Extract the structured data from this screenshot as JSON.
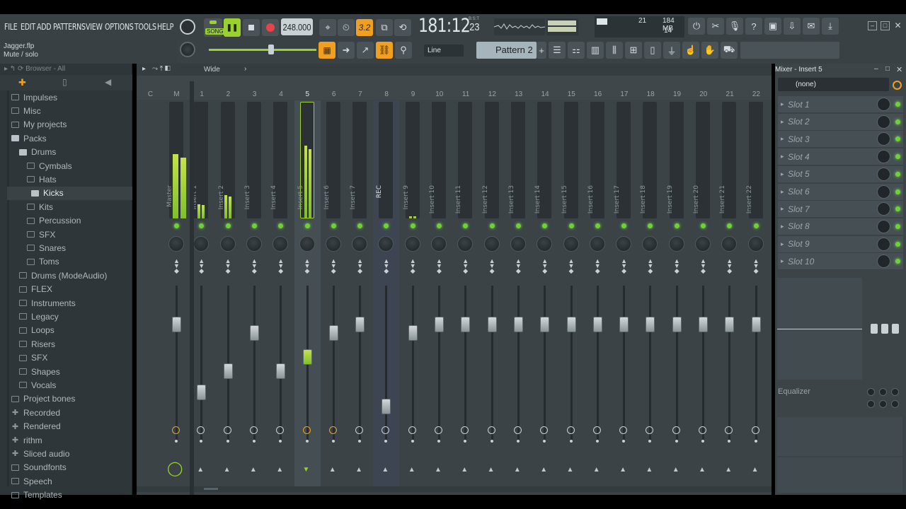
{
  "menu": [
    "FILE",
    "EDIT",
    "ADD",
    "PATTERNS",
    "VIEW",
    "OPTIONS",
    "TOOLS",
    "HELP"
  ],
  "transport": {
    "mode_label": "SONG",
    "tempo": "248.000",
    "time": "181:12",
    "time_ticks": "23",
    "time_unit": "B:S:T",
    "snap_label": "3.2"
  },
  "monitor": {
    "cpu_value": "21",
    "memory": "184 MB",
    "polyphony": "14"
  },
  "hint": {
    "title": "Jagger.flp",
    "message": "Mute / solo"
  },
  "toolbar2": {
    "line_mode": "Line",
    "pattern": "Pattern 2",
    "plus": "+"
  },
  "browser": {
    "header": "Browser - All",
    "items": [
      {
        "label": "Impulses",
        "type": "folder"
      },
      {
        "label": "Misc",
        "type": "folder"
      },
      {
        "label": "My projects",
        "type": "folder"
      },
      {
        "label": "Packs",
        "type": "folder-open"
      },
      {
        "label": "Drums",
        "type": "folder-open",
        "indent": 1
      },
      {
        "label": "Cymbals",
        "type": "folder",
        "indent": 2
      },
      {
        "label": "Hats",
        "type": "folder",
        "indent": 2
      },
      {
        "label": "Kicks",
        "type": "folder",
        "indent": 2,
        "selected": true
      },
      {
        "label": "Kits",
        "type": "folder",
        "indent": 2
      },
      {
        "label": "Percussion",
        "type": "folder",
        "indent": 2
      },
      {
        "label": "SFX",
        "type": "folder",
        "indent": 2
      },
      {
        "label": "Snares",
        "type": "folder",
        "indent": 2
      },
      {
        "label": "Toms",
        "type": "folder",
        "indent": 2
      },
      {
        "label": "Drums (ModeAudio)",
        "type": "folder",
        "indent": 1
      },
      {
        "label": "FLEX",
        "type": "folder",
        "indent": 1
      },
      {
        "label": "Instruments",
        "type": "folder",
        "indent": 1
      },
      {
        "label": "Legacy",
        "type": "folder",
        "indent": 1
      },
      {
        "label": "Loops",
        "type": "folder",
        "indent": 1
      },
      {
        "label": "Risers",
        "type": "folder",
        "indent": 1
      },
      {
        "label": "SFX",
        "type": "folder",
        "indent": 1
      },
      {
        "label": "Shapes",
        "type": "folder",
        "indent": 1
      },
      {
        "label": "Vocals",
        "type": "folder",
        "indent": 1
      },
      {
        "label": "Project bones",
        "type": "folder"
      },
      {
        "label": "Recorded",
        "type": "special"
      },
      {
        "label": "Rendered",
        "type": "special"
      },
      {
        "label": "rithm",
        "type": "special"
      },
      {
        "label": "Sliced audio",
        "type": "special"
      },
      {
        "label": "Soundfonts",
        "type": "folder"
      },
      {
        "label": "Speech",
        "type": "folder"
      },
      {
        "label": "Templates",
        "type": "folder"
      }
    ]
  },
  "mixer": {
    "view_mode": "Wide",
    "header_cols": [
      "C",
      "M",
      "1",
      "2",
      "3",
      "4",
      "5",
      "6",
      "7",
      "8",
      "9",
      "10",
      "11",
      "12",
      "13",
      "14",
      "15",
      "16",
      "17",
      "18",
      "19",
      "20",
      "21",
      "22"
    ],
    "strips": [
      {
        "label": "Master",
        "fader": 0.78,
        "meter": 0.55
      },
      {
        "label": "Insert 1",
        "fader": 0.3,
        "meter": 0.12
      },
      {
        "label": "Insert 2",
        "fader": 0.45,
        "meter": 0.2
      },
      {
        "label": "Insert 3",
        "fader": 0.72,
        "meter": 0.0
      },
      {
        "label": "Insert 4",
        "fader": 0.45,
        "meter": 0.0
      },
      {
        "label": "Insert 5",
        "fader": 0.55,
        "meter": 0.62,
        "selected": true
      },
      {
        "label": "Insert 6",
        "fader": 0.72,
        "meter": 0.0
      },
      {
        "label": "Insert 7",
        "fader": 0.78,
        "meter": 0.0
      },
      {
        "label": "REC",
        "fader": 0.2,
        "meter": 0.0
      },
      {
        "label": "Insert 9",
        "fader": 0.72,
        "meter": 0.02
      },
      {
        "label": "Insert 10",
        "fader": 0.78,
        "meter": 0.0
      },
      {
        "label": "Insert 11",
        "fader": 0.78,
        "meter": 0.0
      },
      {
        "label": "Insert 12",
        "fader": 0.78,
        "meter": 0.0
      },
      {
        "label": "Insert 13",
        "fader": 0.78,
        "meter": 0.0
      },
      {
        "label": "Insert 14",
        "fader": 0.78,
        "meter": 0.0
      },
      {
        "label": "Insert 15",
        "fader": 0.78,
        "meter": 0.0
      },
      {
        "label": "Insert 16",
        "fader": 0.78,
        "meter": 0.0
      },
      {
        "label": "Insert 17",
        "fader": 0.78,
        "meter": 0.0
      },
      {
        "label": "Insert 18",
        "fader": 0.78,
        "meter": 0.0
      },
      {
        "label": "Insert 19",
        "fader": 0.78,
        "meter": 0.0
      },
      {
        "label": "Insert 20",
        "fader": 0.78,
        "meter": 0.0
      },
      {
        "label": "Insert 21",
        "fader": 0.78,
        "meter": 0.0
      },
      {
        "label": "Insert 22",
        "fader": 0.78,
        "meter": 0.0
      }
    ]
  },
  "insert_panel": {
    "title": "Mixer - Insert 5",
    "input": "(none)",
    "slots": [
      "Slot 1",
      "Slot 2",
      "Slot 3",
      "Slot 4",
      "Slot 5",
      "Slot 6",
      "Slot 7",
      "Slot 8",
      "Slot 9",
      "Slot 10"
    ],
    "eq_label": "Equalizer"
  },
  "colors": {
    "accent_green": "#9ad12f",
    "led": "#6fd13a",
    "orange": "#f0a01e",
    "background": "#3b4347"
  }
}
